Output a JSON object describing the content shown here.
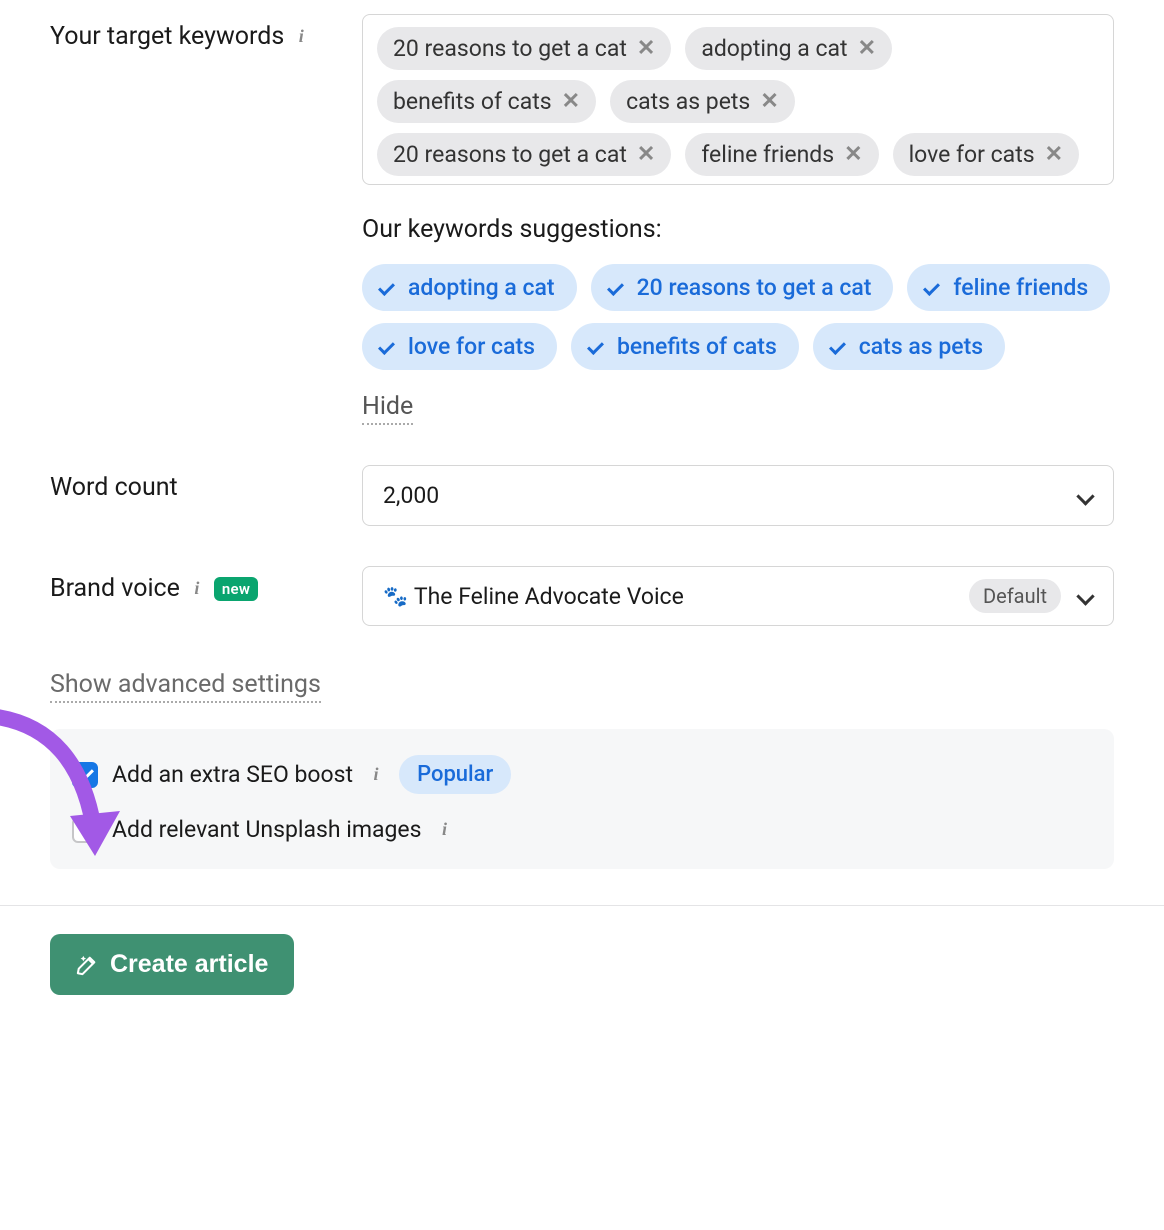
{
  "labels": {
    "target_keywords": "Your target keywords",
    "word_count": "Word count",
    "brand_voice": "Brand voice",
    "show_advanced": "Show advanced settings",
    "suggestions_title": "Our keywords suggestions:",
    "hide": "Hide",
    "new_badge": "new",
    "default_badge": "Default",
    "popular_badge": "Popular"
  },
  "keywords": {
    "items": [
      "20 reasons to get a cat",
      "adopting a cat",
      "benefits of cats",
      "cats as pets",
      "20 reasons to get a cat",
      "feline friends",
      "love for cats"
    ]
  },
  "suggestions": {
    "items": [
      "adopting a cat",
      "20 reasons to get a cat",
      "feline friends",
      "love for cats",
      "benefits of cats",
      "cats as pets"
    ]
  },
  "word_count": {
    "value": "2,000"
  },
  "brand_voice": {
    "value": "The Feline Advocate Voice"
  },
  "options": {
    "seo_boost": {
      "label": "Add an extra SEO boost",
      "checked": true
    },
    "unsplash": {
      "label": "Add relevant Unsplash images",
      "checked": false
    }
  },
  "buttons": {
    "create": "Create article"
  }
}
